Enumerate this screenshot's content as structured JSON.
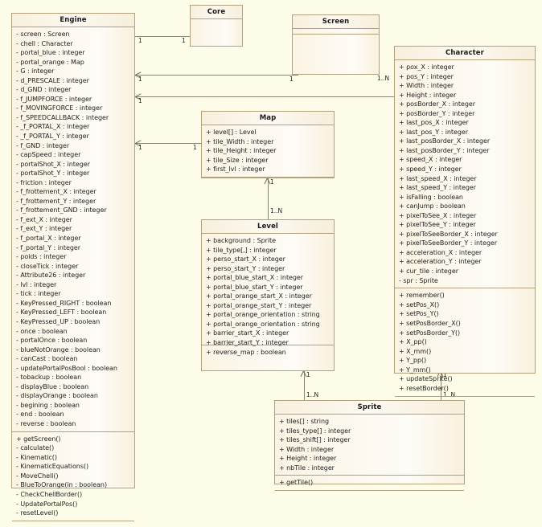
{
  "diagram": {
    "kind": "uml-class-diagram",
    "background_color": "#fdfde9",
    "box_fill_color": "#fbf4e3",
    "box_border_color": "#b3a07c",
    "line_color": "#8a8370"
  },
  "classes": {
    "engine": {
      "name": "Engine",
      "attributes": [
        "- screen : Screen",
        "- chell : Character",
        "- portal_blue : integer",
        "- portal_orange : Map",
        "- G : integer",
        "- d_PRESCALE : integer",
        "- d_GND : integer",
        "- f_JUMPFORCE : integer",
        "- f_MOVINGFORCE : integer",
        "- f_SPEEDCALLBACK : integer",
        "- _f_PORTAL_X : integer",
        "- _f_PORTAL_Y : integer",
        "- f_GND : integer",
        "- capSpeed : integer",
        "- portalShot_X : integer",
        "- portalShot_Y : integer",
        "- friction : integer",
        "- f_frottement_X : integer",
        "- f_frottement_Y : integer",
        "- f_frottement_GND : integer",
        "- f_ext_X : integer",
        "- f_ext_Y : integer",
        "- f_portal_X : integer",
        "- f_portal_Y : integer",
        "- poids : integer",
        "- closeTick : integer",
        "- Attribute26 : integer",
        "- lvl : integer",
        "- tick : integer",
        "- KeyPressed_RIGHT : boolean",
        "- KeyPressed_LEFT : boolean",
        "- KeyPressed_UP : boolean",
        "- once : boolean",
        "- portalOnce : boolean",
        "- blueNotOrange : boolean",
        "- canCast : boolean",
        "- updatePortalPosBool : boolean",
        "- tobackup : boolean",
        "- displayBlue : boolean",
        "- displayOrange : boolean",
        "- begining : boolean",
        "- end : boolean",
        "- reverse : boolean"
      ],
      "operations": [
        "+ getScreen()",
        "- calculate()",
        "- Kinematic()",
        "- KinematicEquations()",
        "- MoveChell()",
        "- BlueToOrange(in : boolean)",
        "- CheckChellBorder()",
        "- UpdatePortalPos()",
        "- resetLevel()"
      ]
    },
    "core": {
      "name": "Core",
      "attributes": [],
      "operations": []
    },
    "screen": {
      "name": "Screen",
      "attributes": [],
      "operations": []
    },
    "character": {
      "name": "Character",
      "attributes": [
        "+ pox_X : integer",
        "+ pos_Y : integer",
        "+ Width : integer",
        "+ Height : integer",
        "+ posBorder_X : integer",
        "+ posBorder_Y : integer",
        "+ last_pos_X : integer",
        "+ last_pos_Y : integer",
        "+ last_posBorder_X : integer",
        "+ last_posBorder_Y : integer",
        "+ speed_X : integer",
        "+ speed_Y : integer",
        "+ last_speed_X : integer",
        "+ last_speed_Y : integer",
        "+ isFalling : boolean",
        "+ canJump : boolean",
        "+ pixelToSee_X : integer",
        "+ pixelToSee_Y : integer",
        "+ pixelToSeeBorder_X : integer",
        "+ pixelToSeeBorder_Y : integer",
        "+ acceleration_X : integer",
        "+ acceleration_Y : integer",
        "+ cur_tile : integer",
        "- spr : Sprite"
      ],
      "operations": [
        "+ remember()",
        "+ setPos_X()",
        "+ setPos_Y()",
        "+ setPosBorder_X()",
        "+ setPosBorder_Y()",
        "+ X_pp()",
        "+ X_mm()",
        "+ Y_pp()",
        "+ Y_mm()",
        "+ updateSprite()",
        "+ resetBorder()"
      ]
    },
    "map": {
      "name": "Map",
      "attributes": [
        "+ level[] : Level",
        "+ tile_Width : integer",
        "+ tile_Height : integer",
        "+ tile_Size : integer",
        "+ first_lvl : integer"
      ],
      "operations": []
    },
    "level": {
      "name": "Level",
      "attributes": [
        "+ background : Sprite",
        "+ tile_type[,] : integer",
        "+ perso_start_X : integer",
        "+ perso_start_Y : integer",
        "+ portal_blue_start_X : integer",
        "+ portal_blue_start_Y : integer",
        "+ portal_orange_start_X : integer",
        "+ portal_orange_start_Y : integer",
        "+ portal_orange_orientation : string",
        "+ portal_orange_orientation : string",
        "+ barrier_start_X : integer",
        "+ barrier_start_Y : integer",
        "+ reverse_map : boolean"
      ],
      "operations": []
    },
    "sprite": {
      "name": "Sprite",
      "attributes": [
        "+ tiles[] : string",
        "+ tiles_type[] : integer",
        "+ tiles_shift[] : integer",
        "+ Width : integer",
        "+ Height : integer",
        "+ nbTile : integer"
      ],
      "operations": [
        "+ getTile()"
      ]
    }
  },
  "multiplicities": {
    "engine_core_src": "1",
    "engine_core_dst": "1",
    "engine_screen_src": "1",
    "engine_screen_dst": "1",
    "engine_character_src": "1",
    "engine_character_dst": "1..N",
    "engine_map_src": "1",
    "engine_map_dst": "1",
    "map_level_src": "1",
    "map_level_dst": "1..N",
    "level_sprite_src": "1",
    "level_sprite_dst": "1..N",
    "character_sprite_src": "1",
    "character_sprite_dst": "1..N"
  }
}
